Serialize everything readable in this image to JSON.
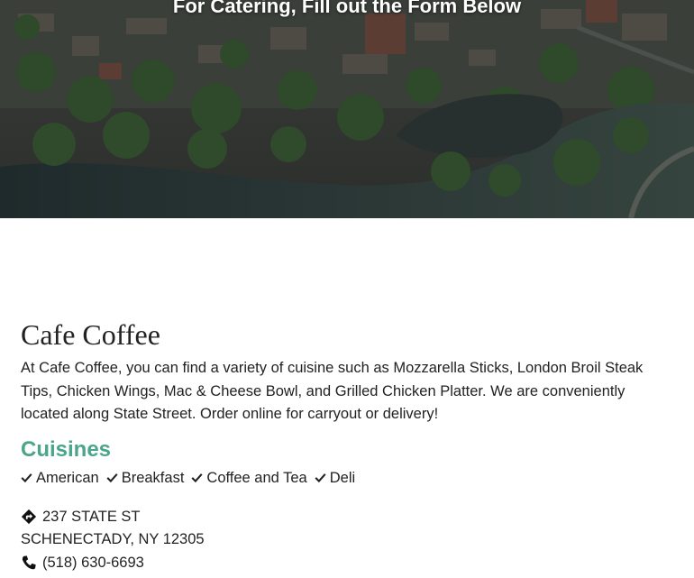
{
  "hero": {
    "heading": "For Catering, Fill out the Form Below"
  },
  "restaurant": {
    "name": "Cafe Coffee",
    "description": "At Cafe Coffee, you can find a variety of cuisine such as Mozzarella Sticks, London Broil Steak Tips, Chicken Wings, Mac & Cheese Bowl, and Grilled Chicken Platter. We are conveniently located along State Street. Order online for carryout or delivery!"
  },
  "cuisines": {
    "heading": "Cuisines",
    "items": [
      "American",
      "Breakfast",
      "Coffee and Tea",
      "Deli"
    ]
  },
  "location": {
    "street": "237 STATE ST",
    "city_state_zip": "SCHENECTADY, NY 12305",
    "phone": "(518) 630-6693"
  },
  "colors": {
    "accent": "#4aa58a",
    "text": "#222222"
  },
  "icons": {
    "check": "check-icon",
    "directions": "directions-icon",
    "phone": "phone-icon"
  }
}
